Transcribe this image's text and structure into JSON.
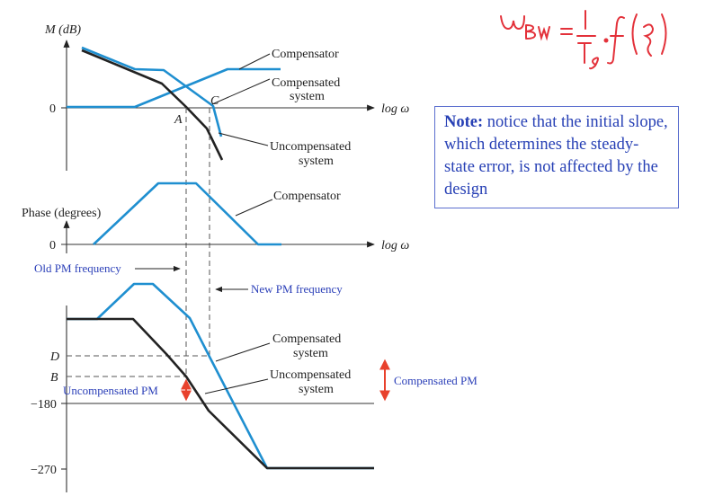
{
  "handwriting": "ω_BW = (1/T_s)·f(ξ)",
  "note": {
    "bold": "Note:",
    "text": " notice that the initial slope, which determines the steady-state error, is not affected by the design"
  },
  "magnitude_plot": {
    "ylabel": "M (dB)",
    "zero_tick": "0",
    "xlabel": "log ω",
    "point_a": "A",
    "point_c": "C",
    "labels": {
      "compensator": "Compensator",
      "compensated_1": "Compensated",
      "compensated_2": "system",
      "uncompensated_1": "Uncompensated",
      "uncompensated_2": "system"
    }
  },
  "phase_plot": {
    "ylabel": "Phase (degrees)",
    "zero_tick": "0",
    "xlabel": "log ω",
    "compensator": "Compensator",
    "old_pm": "Old PM frequency",
    "new_pm": "New PM frequency",
    "tick_d": "D",
    "tick_b": "B",
    "tick_180": "−180",
    "tick_270": "−270",
    "compensated_1": "Compensated",
    "compensated_2": "system",
    "uncompensated_1": "Uncompensated",
    "uncompensated_2": "system",
    "uncomp_pm": "Uncompensated PM",
    "comp_pm": "Compensated PM"
  },
  "colors": {
    "compensated": "#1f8fd0",
    "uncompensated": "#222222",
    "annotation": "#2b3fb8",
    "highlight": "#e8412c"
  }
}
